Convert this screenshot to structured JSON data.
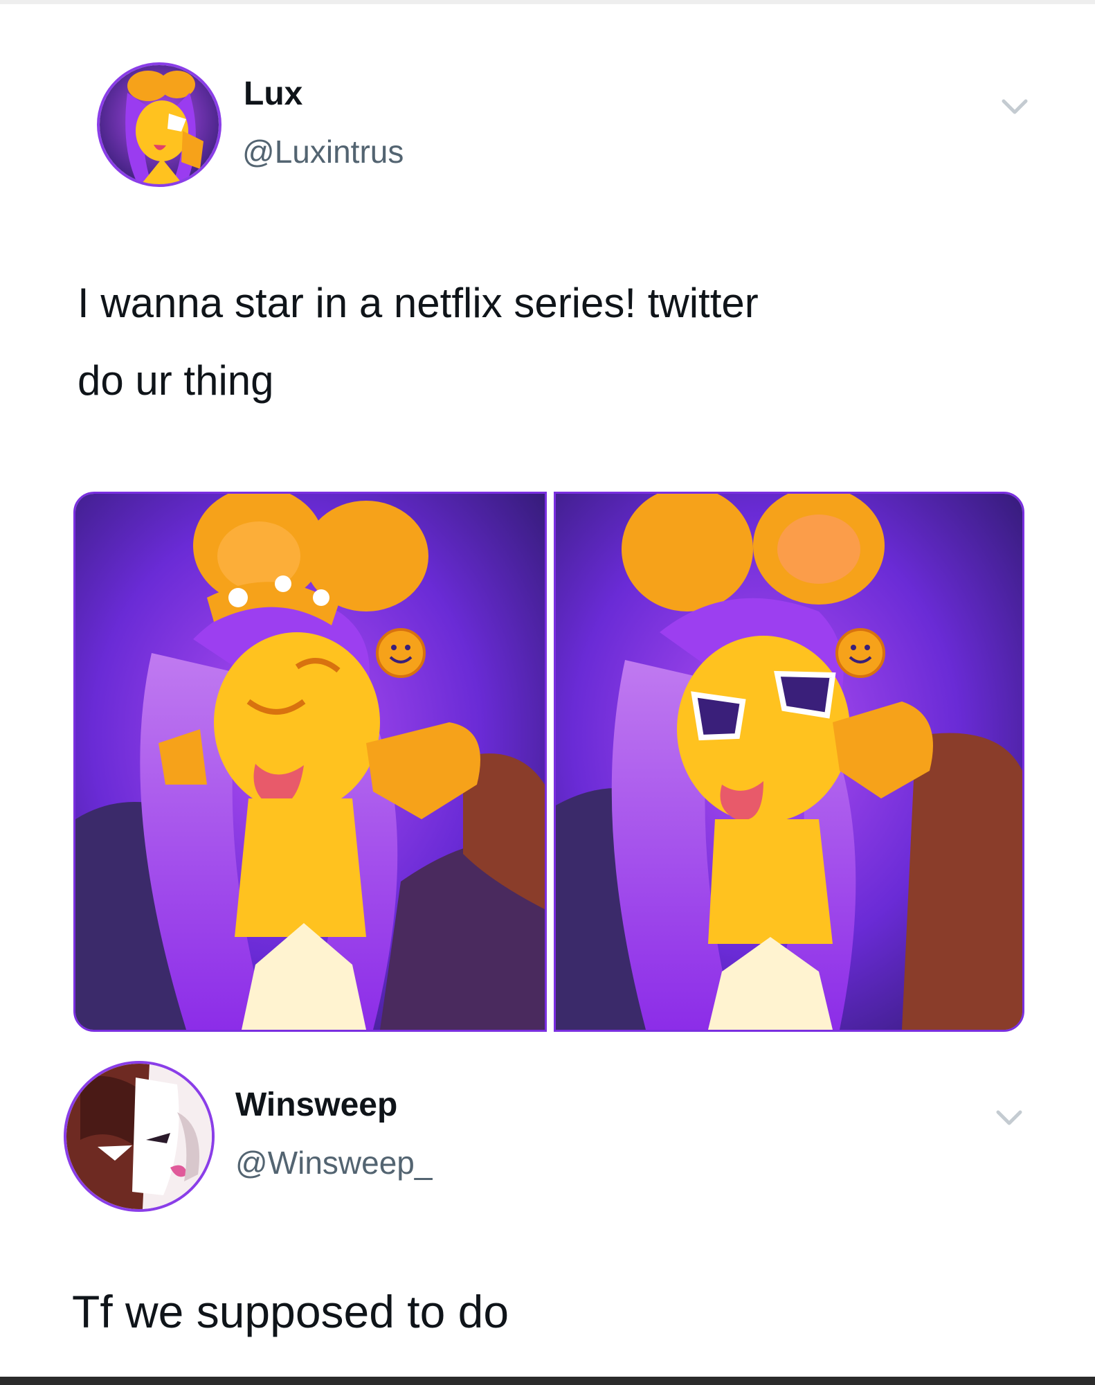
{
  "tweet": {
    "author": {
      "display_name": "Lux",
      "handle": "@Luxintrus"
    },
    "text_line1": "I wanna star in a netflix series! twitter",
    "text_line2": "do ur thing",
    "menu_icon": "chevron-down-icon"
  },
  "reply": {
    "author": {
      "display_name": "Winsweep",
      "handle": "@Winsweep_"
    },
    "text": "Tf we supposed to do",
    "menu_icon": "chevron-down-icon"
  },
  "colors": {
    "purple": "#7b2ee6",
    "deep_purple": "#3a1f7a",
    "orange": "#f6a21a",
    "yellow": "#ffc21f",
    "handle_gray": "#536471"
  }
}
